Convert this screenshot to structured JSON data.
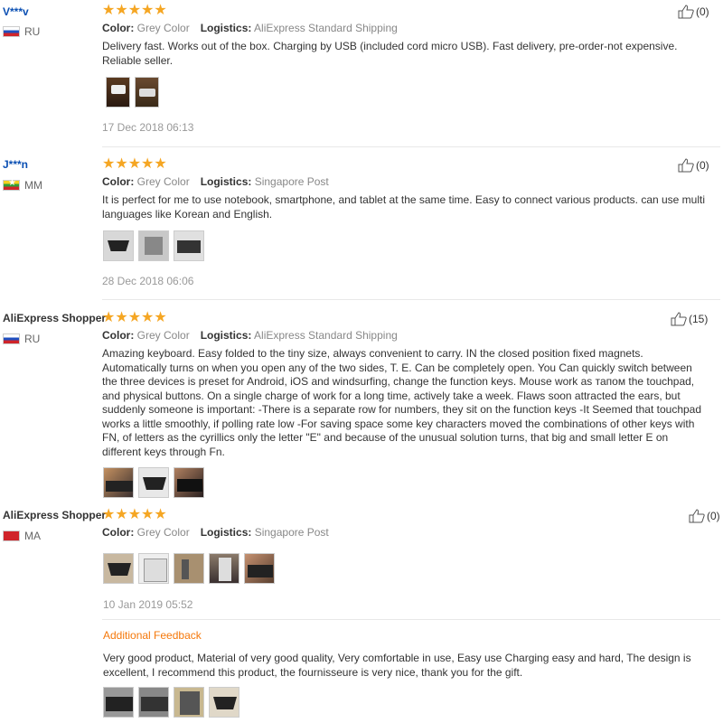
{
  "reviews": [
    {
      "user": "V***v",
      "country": "RU",
      "stars": "★★★★★",
      "color_label": "Color:",
      "color": "Grey Color",
      "logistics_label": "Logistics:",
      "logistics": "AliExpress Standard Shipping",
      "helpful": "(0)",
      "text": "Delivery fast. Works out of the box. Charging by USB (included cord micro USB). Fast delivery, pre-order-not expensive. Reliable seller.",
      "date": "17 Dec 2018 06:13"
    },
    {
      "user": "J***n",
      "country": "MM",
      "stars": "★★★★★",
      "color_label": "Color:",
      "color": "Grey Color",
      "logistics_label": "Logistics:",
      "logistics": "Singapore Post",
      "helpful": "(0)",
      "text": "It is perfect for me to use notebook, smartphone, and tablet at the same time. Easy to connect various products. can use multi languages like Korean and English.",
      "date": "28 Dec 2018 06:06"
    },
    {
      "user": "AliExpress Shopper",
      "country": "RU",
      "stars": "★★★★★",
      "color_label": "Color:",
      "color": "Grey Color",
      "logistics_label": "Logistics:",
      "logistics": "AliExpress Standard Shipping",
      "helpful": "(15)",
      "text": "Amazing keyboard. Easy folded to the tiny size, always convenient to carry. IN the closed position fixed magnets. Automatically turns on when you open any of the two sides, T. E. Can be completely open. You Can quickly switch between the three devices is preset for Android, iOS and windsurfing, change the function keys. Mouse work as тапом the touchpad, and physical buttons. On a single charge of work for a long time, actively take a week. Flaws soon attracted the ears, but suddenly someone is important: -There is a separate row for numbers, they sit on the function keys -It Seemed that touchpad works a little smoothly, if polling rate low -For saving space some key characters moved the combinations of other keys with FN, of letters as the cyrillics only the letter \"E\" and because of the unusual solution turns, that big and small letter E on different keys through Fn."
    },
    {
      "user": "AliExpress Shopper",
      "country": "MA",
      "stars": "★★★★★",
      "color_label": "Color:",
      "color": "Grey Color",
      "logistics_label": "Logistics:",
      "logistics": "Singapore Post",
      "helpful": "(0)",
      "date": "10 Jan 2019 05:52",
      "additional_label": "Additional Feedback",
      "additional_text": "Very good product, Material of very good quality, Very comfortable in use, Easy use Charging easy and hard, The design is excellent, I recommend this product, the fournisseure is very nice, thank you for the gift."
    }
  ],
  "colors": {
    "star": "#f5a623",
    "link": "#0a4fb3",
    "accent": "#f5780a"
  }
}
